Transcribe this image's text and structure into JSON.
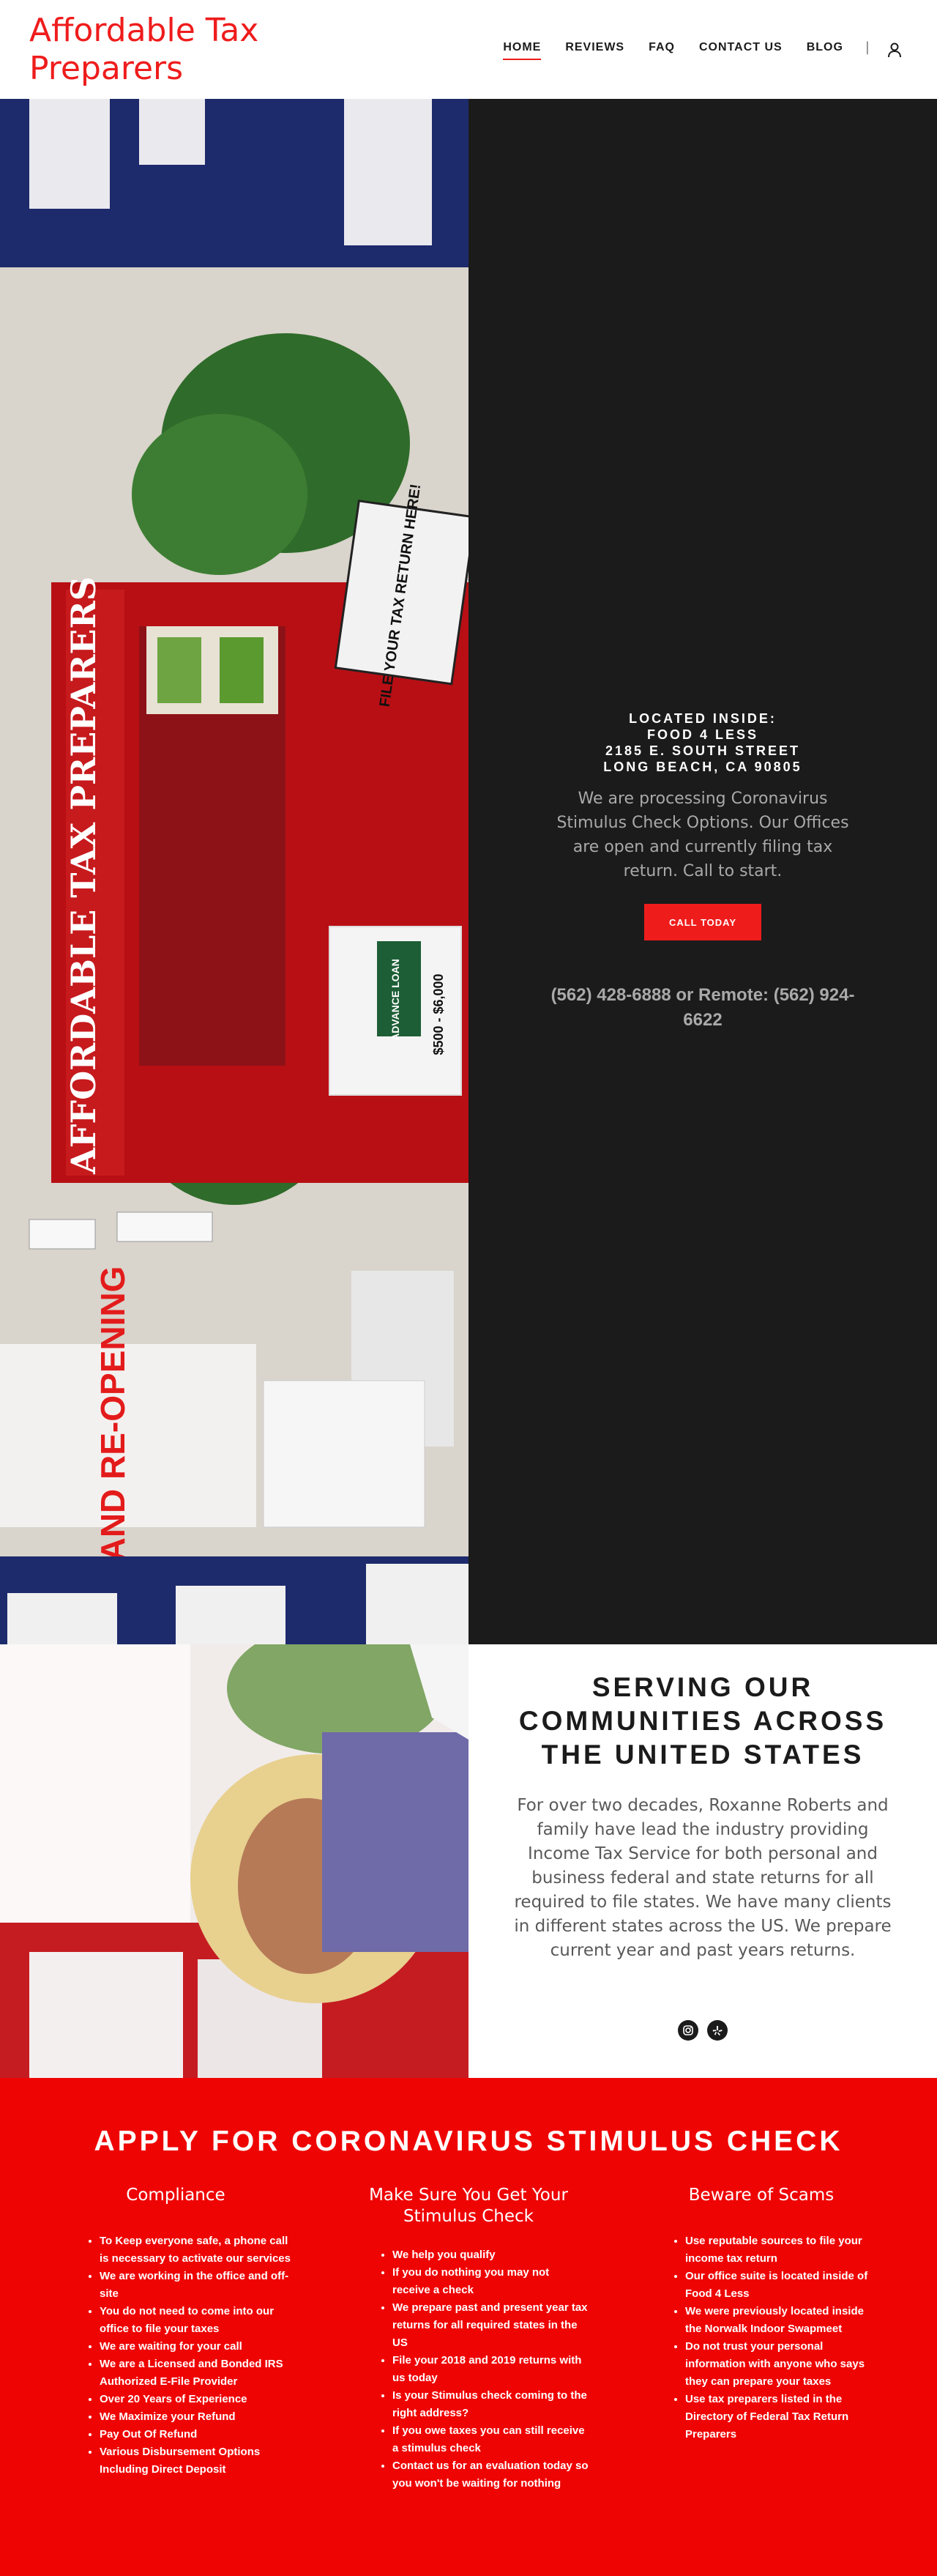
{
  "header": {
    "brand": "Affordable Tax Preparers",
    "nav": [
      "HOME",
      "REVIEWS",
      "FAQ",
      "CONTACT US",
      "BLOG"
    ],
    "separator": "|",
    "user_icon": "user-icon"
  },
  "hero": {
    "photo_sign_main": "AFFORDABLE TAX PREPARERS",
    "photo_sign_file": "FILE YOUR TAX RETURN HERE!",
    "photo_sign_grand": "GRAND RE-OPENING",
    "photo_sign_advance": "ADVANCE LOAN",
    "photo_sign_amount": "$500 - $6,000",
    "location_lines": [
      "LOCATED INSIDE:",
      "FOOD 4 LESS",
      "2185 E. SOUTH STREET",
      "LONG BEACH, CA 90805"
    ],
    "lede": "We are processing Coronavirus Stimulus Check Options.  Our Offices are open and currently filing tax return.   Call to start.",
    "cta": "CALL TODAY",
    "phones": "(562) 428-6888 or Remote: (562) 924-6622"
  },
  "serving": {
    "title": "SERVING OUR COMMUNITIES ACROSS THE UNITED STATES",
    "body": "For over two decades, Roxanne Roberts and family have lead the industry providing Income Tax Service for both personal and business federal and state returns for all required to file states.  We have many clients in different states across the US.  We prepare current year and past years returns.",
    "social_icons": [
      "instagram-icon",
      "yelp-icon"
    ]
  },
  "stimulus": {
    "title": "APPLY FOR CORONAVIRUS STIMULUS CHECK",
    "columns": [
      {
        "heading": "Compliance",
        "items": [
          "To Keep everyone safe, a phone call is necessary to activate our services",
          "We are working in the office and off-site",
          "You do not need to come into our office to file your taxes",
          "We are waiting for your call",
          "We are a Licensed and Bonded IRS Authorized E-File Provider",
          "Over 20 Years of Experience",
          "We Maximize your Refund",
          "Pay Out Of Refund",
          "Various Disbursement Options Including Direct Deposit"
        ]
      },
      {
        "heading": "Make Sure You Get Your Stimulus Check",
        "items": [
          "We help you qualify",
          "If you do nothing you may not receive a check",
          "We prepare past and present year tax returns for all required states in the US",
          "File your 2018 and 2019 returns with us today",
          "Is your Stimulus check coming to the right address?",
          "If you owe taxes you can still receive a stimulus check",
          "Contact us for an evaluation today so you won't  be waiting for nothing"
        ]
      },
      {
        "heading": "Beware of Scams",
        "items": [
          "Use reputable sources to file your income tax return",
          "Our office suite is located inside of Food 4 Less",
          "We were previously located inside the Norwalk Indoor Swapmeet",
          "Do not trust your personal information with anyone who says they can prepare your taxes",
          "Use tax preparers listed in the Directory of Federal Tax Return Preparers"
        ]
      }
    ]
  },
  "colors": {
    "brand_red": "#ef1c1c",
    "section_red": "#ef0404",
    "dark": "#1b1b1b"
  }
}
